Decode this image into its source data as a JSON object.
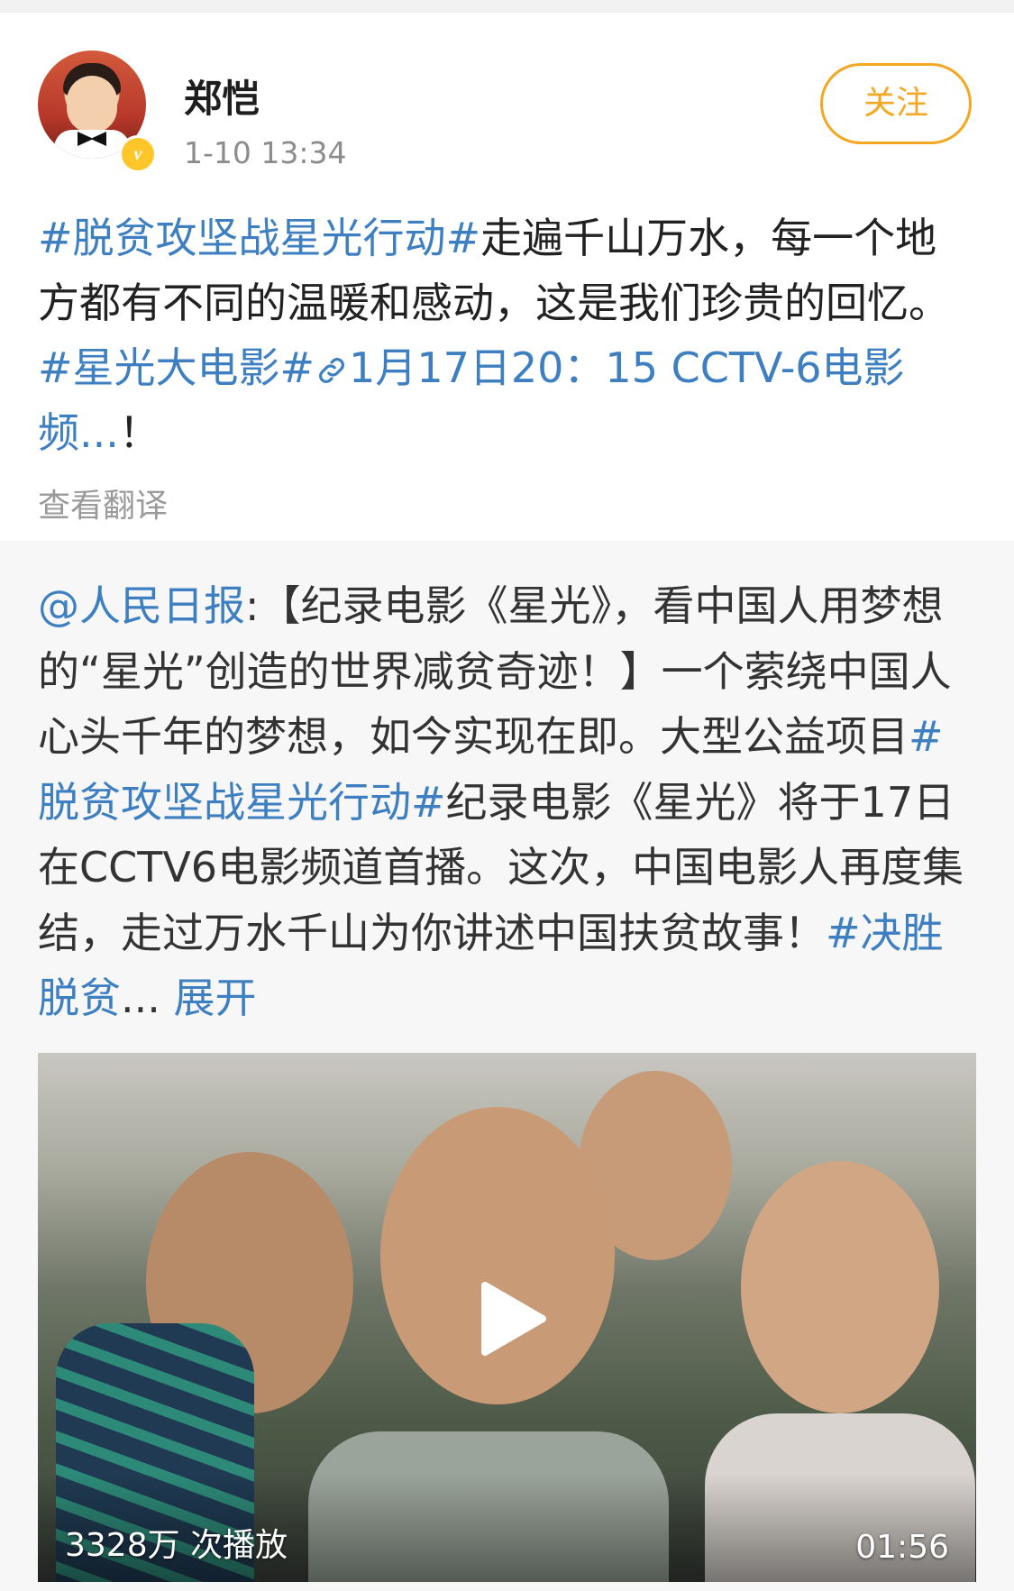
{
  "post": {
    "author": "郑恺",
    "time": "1-10 13:34",
    "follow_label": "关注",
    "text": {
      "topic1": "#脱贫攻坚战星光行动#",
      "seg1": "走遍千山万水，每一个地方都有不同的温暖和感动，这是我们珍贵的回忆。",
      "topic2": "#星光大电影#",
      "link_icon": "link-icon",
      "link_text": "1月17日20：15 CCTV-6电影频...",
      "tail": "！"
    },
    "translate_label": "查看翻译"
  },
  "repost": {
    "mention": "@人民日报",
    "seg1": ":【纪录电影《星光》，看中国人用梦想的“星光”创造的世界减贫奇迹！】一个萦绕中国人心头千年的梦想，如今实现在即。大型公益项目",
    "topic1": "#脱贫攻坚战星光行动#",
    "seg2": "纪录电影《星光》将于17日在CCTV6电影频道首播。这次，中国电影人再度集结，走过万水千山为你讲述中国扶贫故事！",
    "topic2": "#决胜脱贫",
    "ellipsis": "...",
    "expand_label": "展开",
    "video": {
      "views": "3328万 次播放",
      "duration": "01:56"
    }
  },
  "colors": {
    "link": "#3d7fc1",
    "follow": "#f5a623",
    "verified": "#ffc62a"
  }
}
